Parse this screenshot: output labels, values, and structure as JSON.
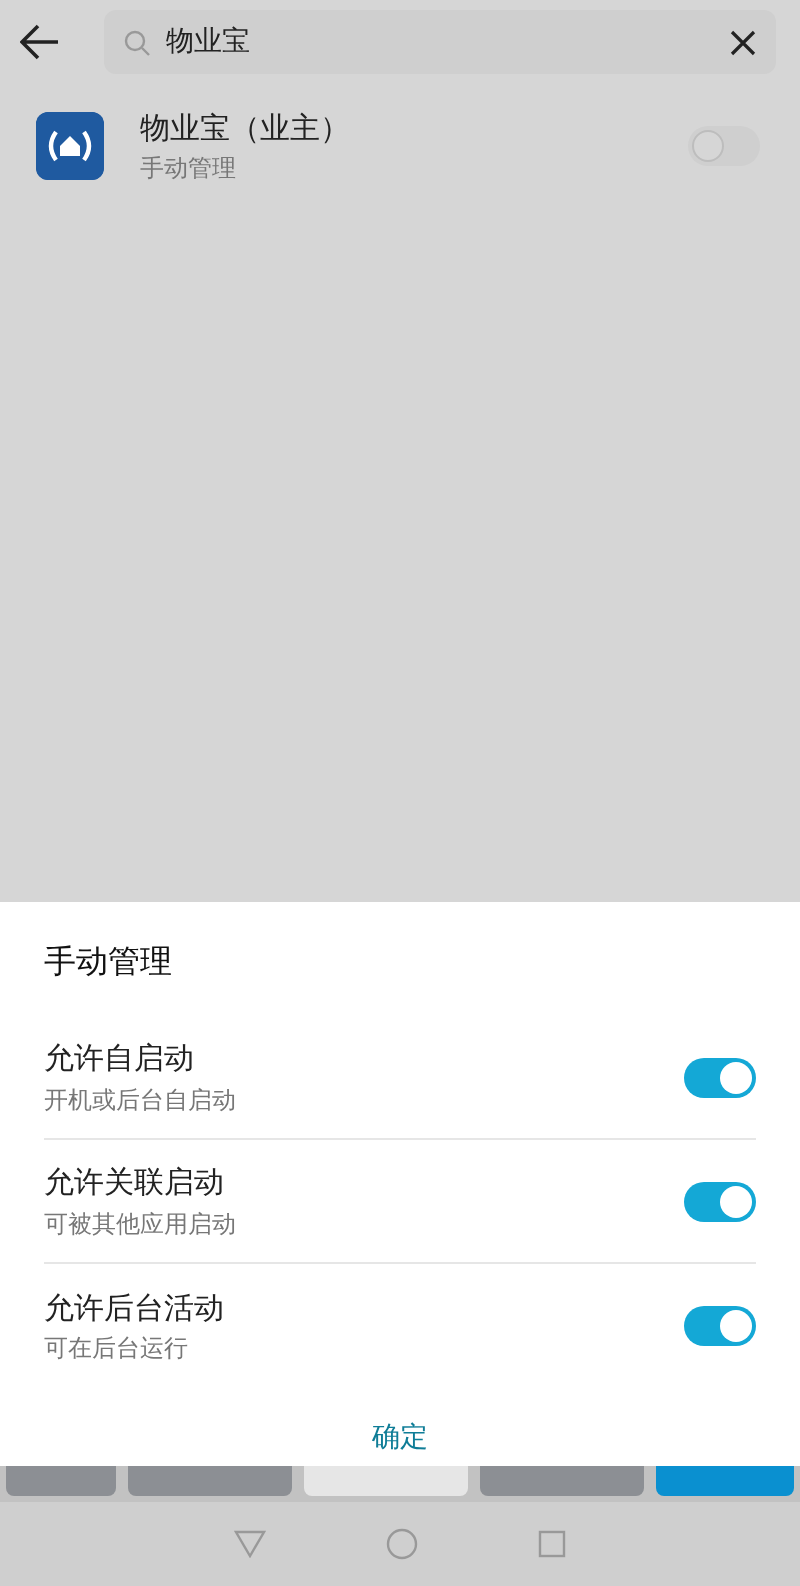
{
  "search": {
    "value": "物业宝"
  },
  "results": [
    {
      "name": "物业宝（业主）",
      "subtitle": "手动管理",
      "on": false
    }
  ],
  "dialog": {
    "title": "手动管理",
    "options": [
      {
        "label": "允许自启动",
        "description": "开机或后台自启动",
        "on": true
      },
      {
        "label": "允许关联启动",
        "description": "可被其他应用启动",
        "on": true
      },
      {
        "label": "允许后台活动",
        "description": "可在后台运行",
        "on": true
      }
    ],
    "button": "确定"
  }
}
